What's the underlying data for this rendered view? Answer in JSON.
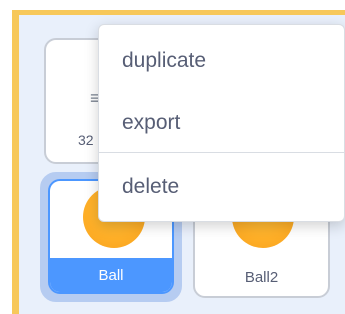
{
  "sprites": [
    {
      "hint": "≡",
      "size_label": "32",
      "selected": false
    },
    {
      "name": "Ball",
      "selected": true
    },
    {
      "name": "Ball2",
      "selected": false
    }
  ],
  "context_menu": {
    "items": [
      {
        "label": "duplicate"
      },
      {
        "label": "export"
      },
      {
        "label": "delete"
      }
    ]
  },
  "colors": {
    "frame_accent": "#f7c85a",
    "selected_blue": "#4c97ff",
    "ball_orange": "#ffb028",
    "text_gray": "#575e75"
  }
}
